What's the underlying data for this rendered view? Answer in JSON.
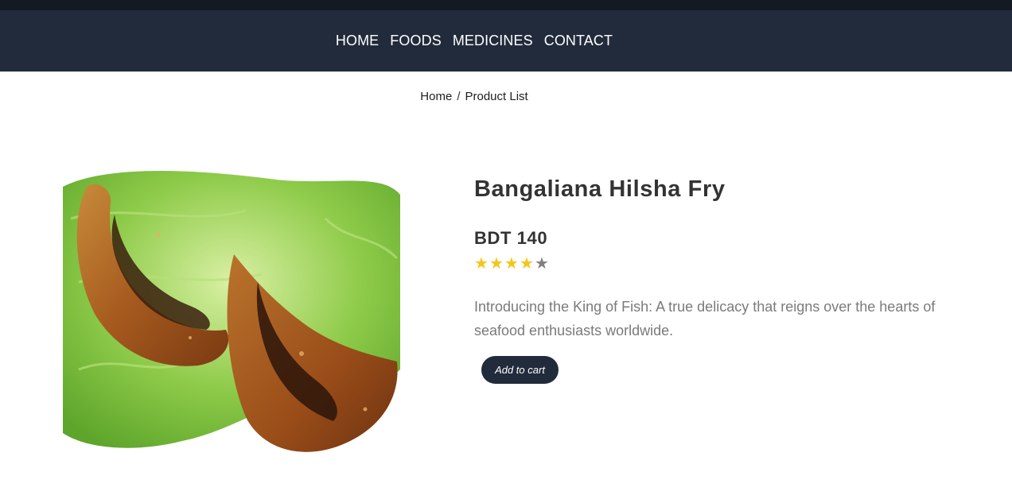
{
  "nav": {
    "items": [
      {
        "label": "HOME"
      },
      {
        "label": "FOODS"
      },
      {
        "label": "MEDICINES"
      },
      {
        "label": "CONTACT"
      }
    ]
  },
  "breadcrumb": {
    "home": "Home",
    "separator": "/",
    "current": "Product List"
  },
  "product": {
    "title": "Bangaliana Hilsha Fry",
    "price": "BDT 140",
    "rating": 4,
    "rating_max": 5,
    "star_glyph": "★",
    "description": "Introducing the King of Fish: A true delicacy that reigns over the hearts of seafood enthusiasts worldwide.",
    "add_to_cart_label": "Add to cart",
    "image_icon": "fried-hilsha-fish-on-lettuce"
  },
  "colors": {
    "navbar": "#222b3b",
    "star_full": "#f5c518",
    "star_empty": "#808080"
  }
}
